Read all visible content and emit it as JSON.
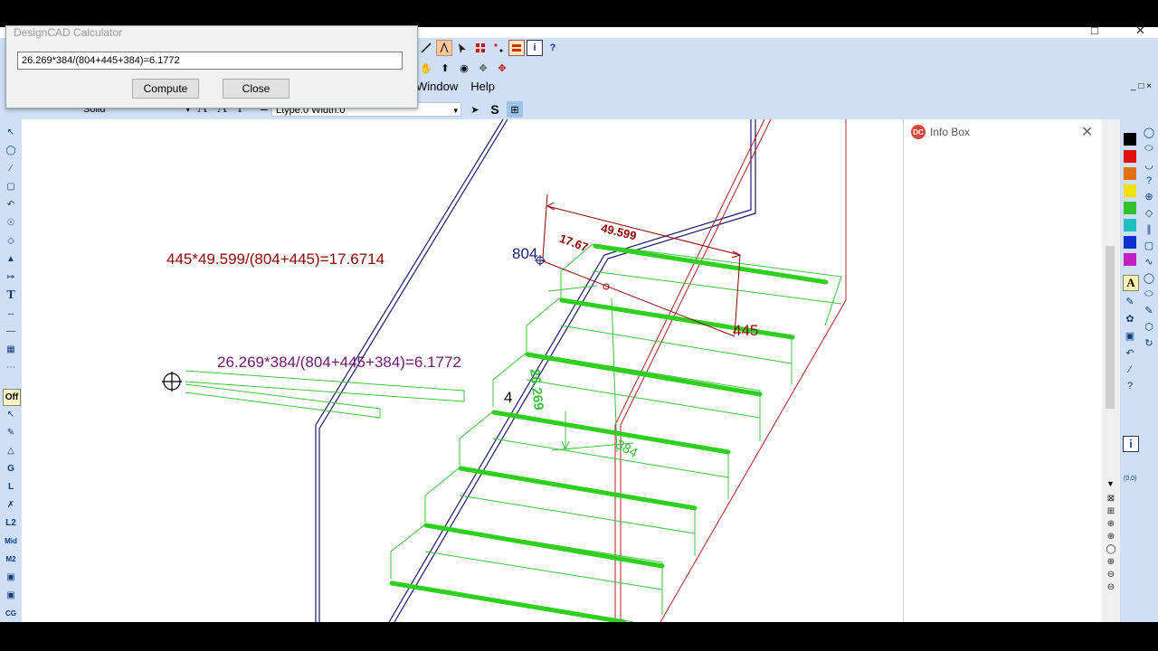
{
  "calculator": {
    "title": "DesignCAD Calculator",
    "expression": "26.269*384/(804+445+384)=6.1772",
    "compute_label": "Compute",
    "close_label": "Close"
  },
  "menu": {
    "items": [
      "Window",
      "Help"
    ]
  },
  "properties": {
    "line_style": "Solid",
    "ltype_width": "Ltype:0  Width:0"
  },
  "info_box": {
    "title": "Info Box",
    "logo": "DC"
  },
  "left_toolbar": {
    "off_label": "Off",
    "labels": [
      "G",
      "L",
      "L2",
      "Mid",
      "M2",
      "CG"
    ]
  },
  "right_toolbar": {
    "text_label": "A",
    "mark_label": "(0,0)",
    "i_label": "i",
    "q_label": "?"
  },
  "colors": {
    "accent": "#2a9d2a",
    "dim_red": "#8b0000",
    "dim_purple": "#6b1a6b",
    "dim_navy": "#1a1a6b",
    "swatches": [
      "#000000",
      "#e01010",
      "#e07010",
      "#f0e010",
      "#30c030",
      "#20c0c0",
      "#1030d0",
      "#c020c0"
    ]
  },
  "drawing": {
    "formula_red": "445*49.599/(804+445)=17.6714",
    "formula_purple": "26.269*384/(804+445+384)=6.1772",
    "dim_49": "49.599",
    "dim_17": "17.67",
    "label_804": "804",
    "label_445": "445",
    "label_4": "4",
    "label_26": "26.269",
    "label_384": "384"
  }
}
